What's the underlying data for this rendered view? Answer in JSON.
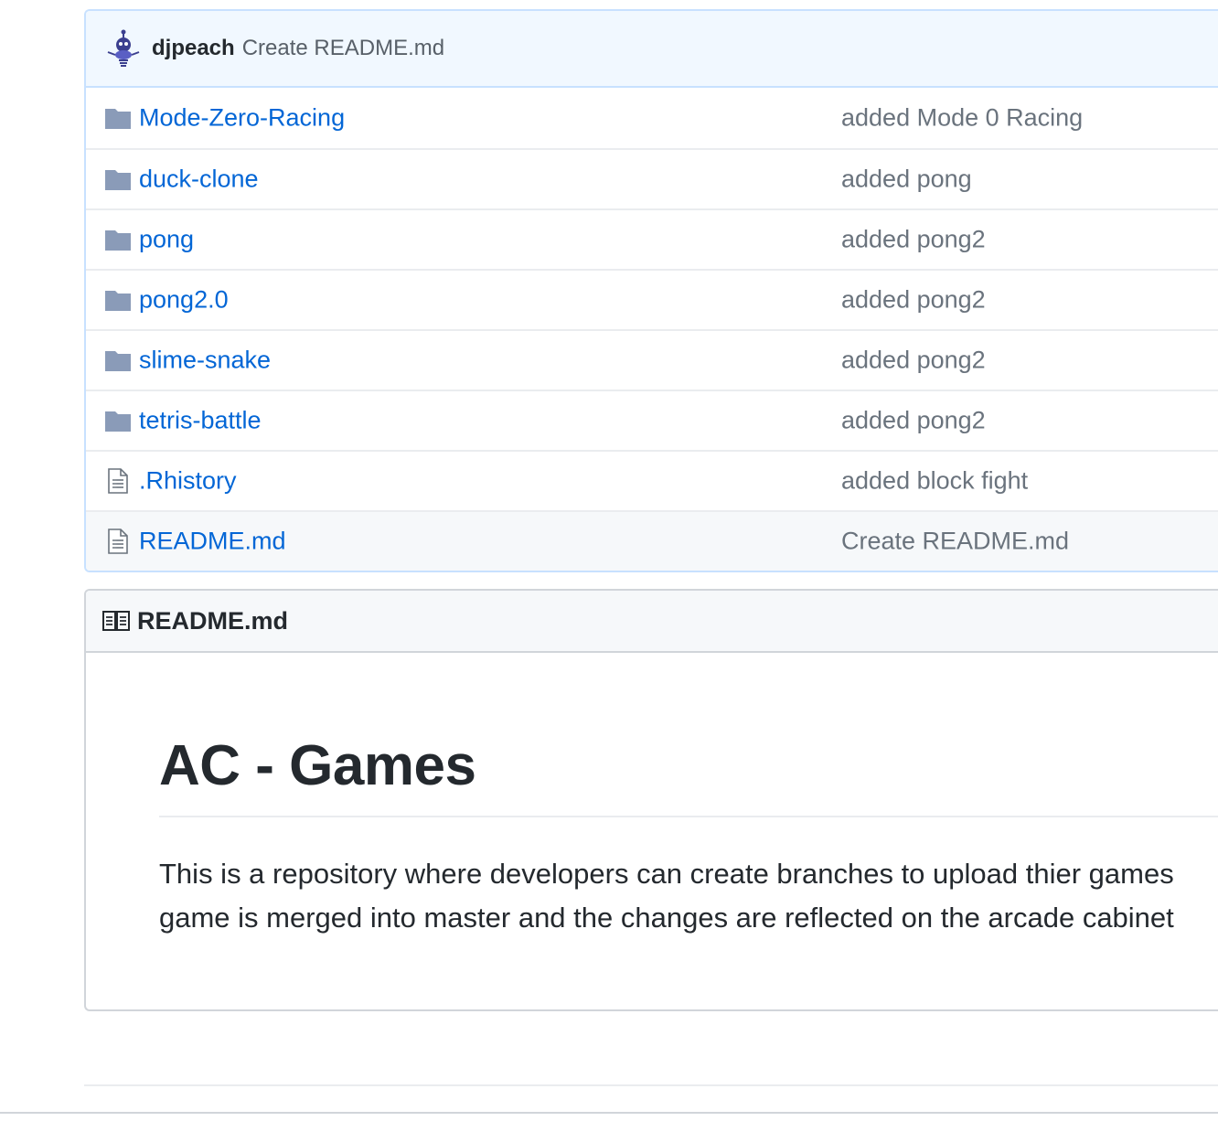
{
  "latest_commit": {
    "author": "djpeach",
    "message": "Create README.md",
    "avatar_icon": "robot-avatar-icon"
  },
  "files": [
    {
      "type": "folder",
      "name": "Mode-Zero-Racing",
      "commit": "added Mode 0 Racing"
    },
    {
      "type": "folder",
      "name": "duck-clone",
      "commit": "added pong"
    },
    {
      "type": "folder",
      "name": "pong",
      "commit": "added pong2"
    },
    {
      "type": "folder",
      "name": "pong2.0",
      "commit": "added pong2"
    },
    {
      "type": "folder",
      "name": "slime-snake",
      "commit": "added pong2"
    },
    {
      "type": "folder",
      "name": "tetris-battle",
      "commit": "added pong2"
    },
    {
      "type": "file",
      "name": ".Rhistory",
      "commit": "added block fight"
    },
    {
      "type": "file",
      "name": "README.md",
      "commit": "Create README.md"
    }
  ],
  "readme": {
    "header_label": "README.md",
    "heading": "AC - Games",
    "paragraph_line1": "This is a repository where developers can create branches to upload thier games",
    "paragraph_line2": "game is merged into master and the changes are reflected on the arcade cabinet"
  },
  "colors": {
    "link": "#0366d6",
    "folder_icon": "#79b8ff",
    "commit_bar_bg": "#f1f8ff",
    "muted_text": "#6a737d"
  }
}
